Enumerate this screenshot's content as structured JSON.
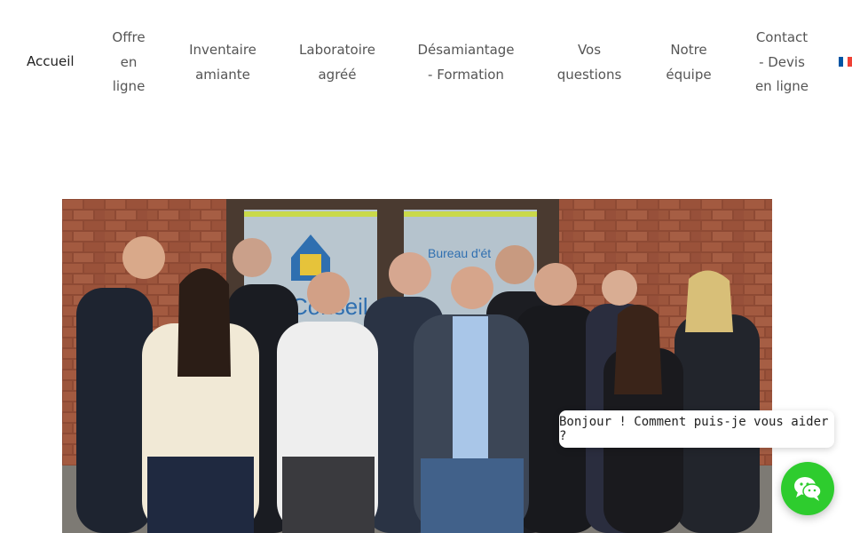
{
  "nav": {
    "items": [
      {
        "label": "Accueil",
        "active": true
      },
      {
        "label": "Offre\nen\nligne"
      },
      {
        "label": "Inventaire\namiante"
      },
      {
        "label": "Laboratoire\nagréé"
      },
      {
        "label": "Désamiantage\n- Formation"
      },
      {
        "label": "Vos\nquestions"
      },
      {
        "label": "Notre\néquipe"
      },
      {
        "label": "Contact\n- Devis\nen ligne"
      }
    ],
    "language_flag_colors": [
      "#0055a4",
      "#ffffff",
      "#ef4135"
    ]
  },
  "hero_photo": {
    "sign_text": "Conseil",
    "window_text": "Bureau d'ét"
  },
  "chat": {
    "greeting": "Bonjour ! Comment puis-je vous aider ?",
    "button_icon": "wechat-icon",
    "button_color": "#2ecc2e"
  }
}
